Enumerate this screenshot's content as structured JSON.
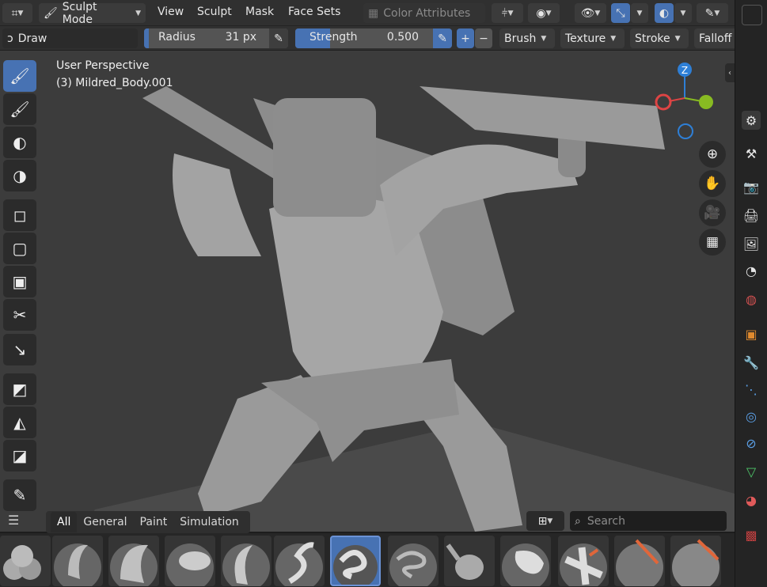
{
  "header": {
    "editor_icon": "editor-type-icon",
    "mode_label": "Sculpt Mode",
    "menus": [
      "View",
      "Sculpt",
      "Mask",
      "Face Sets"
    ],
    "color_attributes_label": "Color Attributes"
  },
  "toolsettings": {
    "brush_name": "Draw",
    "radius_label": "Radius",
    "radius_value": "31 px",
    "strength_label": "Strength",
    "strength_value": "0.500",
    "strength_fraction": 0.5,
    "plus": "+",
    "minus": "−",
    "brush_menu": "Brush",
    "texture_menu": "Texture",
    "stroke_menu": "Stroke",
    "falloff_menu": "Falloff"
  },
  "viewport": {
    "view_name": "User Perspective",
    "object_name": "(3) Mildred_Body.001",
    "gizmo_z": "Z",
    "accent": "#4772b3"
  },
  "shelf": {
    "tabs": [
      "All",
      "General",
      "Paint",
      "Simulation"
    ],
    "active_tab": "All",
    "search_placeholder": "Search"
  }
}
